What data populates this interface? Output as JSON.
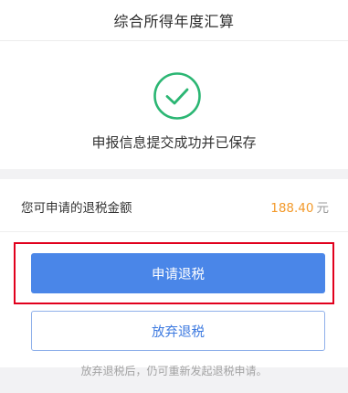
{
  "header": {
    "title": "综合所得年度汇算"
  },
  "success": {
    "icon": "check-circle-icon",
    "message": "申报信息提交成功并已保存",
    "accent": "#2bb673"
  },
  "refund": {
    "label": "您可申请的退税金额",
    "amount": "188.40",
    "unit": "元",
    "amount_color": "#f39a2b"
  },
  "actions": {
    "apply_label": "申请退税",
    "abandon_label": "放弃退税",
    "primary_color": "#4a86e8"
  },
  "hint": {
    "text": "放弃退税后，仍可重新发起退税申请。"
  },
  "highlight": {
    "color": "#e1001d"
  }
}
